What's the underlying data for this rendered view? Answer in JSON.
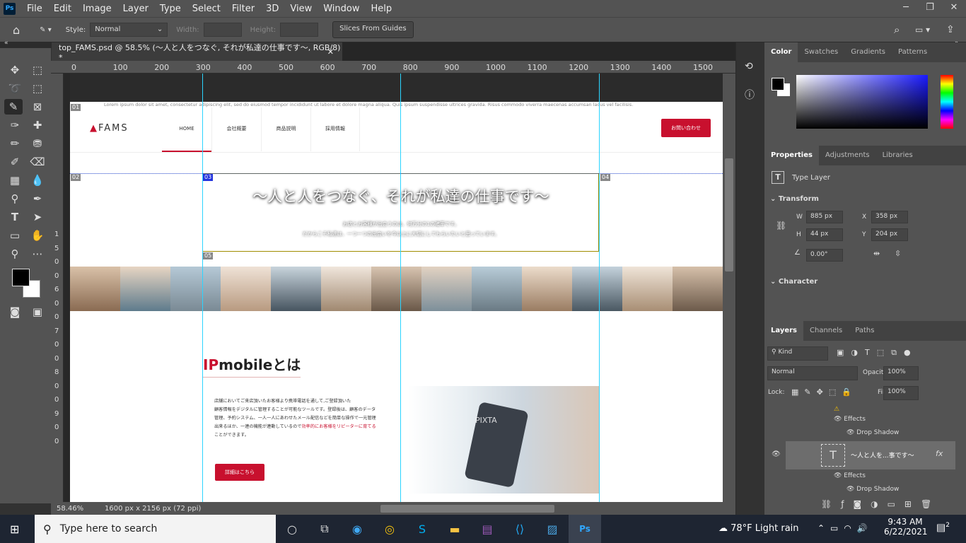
{
  "app": {
    "logo": "Ps",
    "menu": [
      "File",
      "Edit",
      "Image",
      "Layer",
      "Type",
      "Select",
      "Filter",
      "3D",
      "View",
      "Window",
      "Help"
    ]
  },
  "options": {
    "style_label": "Style:",
    "style_value": "Normal",
    "width_label": "Width:",
    "height_label": "Height:",
    "slices_button": "Slices From Guides"
  },
  "document": {
    "tab_title": "top_FAMS.psd @ 58.5% (〜人と人をつなぐ, それが私達の仕事です〜, RGB/8) *",
    "zoom": "58.46%",
    "size": "1600 px x 2156 px (72 ppi)"
  },
  "ruler": {
    "top": [
      "0",
      "100",
      "200",
      "300",
      "400",
      "500",
      "600",
      "700",
      "800",
      "900",
      "1000",
      "1100",
      "1200",
      "1300",
      "1400",
      "1500"
    ],
    "left": [
      "1",
      "5",
      "0",
      "0",
      "6",
      "0",
      "0",
      "7",
      "0",
      "0",
      "8",
      "0",
      "0",
      "9",
      "0",
      "0"
    ]
  },
  "site": {
    "lorem": "Lorem ipsum dolor sit amet, consectetur adipiscing elit, sed do eiusmod tempor incididunt ut labore et dolore magna aliqua. Quis ipsum suspendisse ultrices gravida. Risus commodo viverra maecenas accumsan lacus vel facilisis.",
    "logo": "FAMS",
    "nav": [
      "HOME",
      "会社概要",
      "商品説明",
      "採用情報"
    ],
    "contact": "お問い合わせ",
    "hero_title": "〜人と人をつなぐ、それが私達の仕事です〜",
    "hero_sub1": "お店とお客様が出会うのは、何万分の1の確率です。",
    "hero_sub2": "だからこそ私達は、一つ一つの出会いを今以上に大切にしてもらいたいと思っています。",
    "section_title_accent": "IP",
    "section_title_rest": "mobileとは",
    "body_lines": [
      "店舗においてご来店頂いたお客様より携帯電話を通して,ご登録頂いた",
      "顧客情報をデジタルに管理することが可能なツールです。登録後は、顧客のデータ",
      "管理、予約システム、一人一人にあわせたメール配信などを簡単な操作で一元管理",
      "出来るほか、一連の機能が連動しているので"
    ],
    "body_highlight": "効率的にお客様をリピーターに育てる",
    "body_tail": "ことができます。",
    "detail_button": "詳細はこちら",
    "watermark": "PIXTA",
    "slice_labels": [
      "01",
      "02",
      "03",
      "04",
      "05"
    ]
  },
  "panels": {
    "color_tabs": [
      "Color",
      "Swatches",
      "Gradients",
      "Patterns"
    ],
    "prop_tabs": [
      "Properties",
      "Adjustments",
      "Libraries"
    ],
    "type_layer": "Type Layer",
    "transform": "Transform",
    "w": "885 px",
    "x": "358 px",
    "h": "44 px",
    "y": "204 px",
    "angle": "0.00°",
    "character": "Character",
    "layer_tabs": [
      "Layers",
      "Channels",
      "Paths"
    ],
    "kind": "Kind",
    "blend": "Normal",
    "opacity_label": "Opacity:",
    "opacity": "100%",
    "lock_label": "Lock:",
    "fill_label": "Fill:",
    "fill": "100%",
    "effects": "Effects",
    "drop_shadow": "Drop Shadow",
    "layer_name": "〜人と人を...事です〜"
  },
  "taskbar": {
    "search": "Type here to search",
    "weather": "78°F  Light rain",
    "time": "9:43 AM",
    "date": "6/22/2021",
    "notif": "2"
  }
}
